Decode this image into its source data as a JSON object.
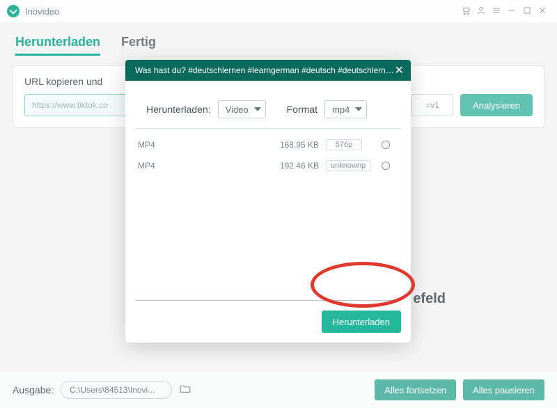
{
  "app": {
    "name": "Inovideo"
  },
  "tabs": {
    "download": "Herunterladen",
    "done": "Fertig"
  },
  "panel": {
    "label": "URL kopieren und",
    "url": "https://www.tiktok.co",
    "v1": "=v1",
    "analyze": "Analysieren"
  },
  "bg_hint": "efeld",
  "footer": {
    "label": "Ausgabe:",
    "path": "C:\\Users\\84513\\Inovi...",
    "resume": "Alles fortsetzen",
    "pause": "Alles pausieren"
  },
  "modal": {
    "title": "Was hast du? #deutschlernen #learngerman #deutsch #deutschlernenb...",
    "download_label": "Herunterladen:",
    "download_value": "Video",
    "format_label": "Format",
    "format_value": "mp4",
    "rows": [
      {
        "fmt": "MP4",
        "size": "168.95 KB",
        "quality": "576p"
      },
      {
        "fmt": "MP4",
        "size": "192.46 KB",
        "quality": "unknownp"
      }
    ],
    "download_btn": "Herunterladen"
  }
}
